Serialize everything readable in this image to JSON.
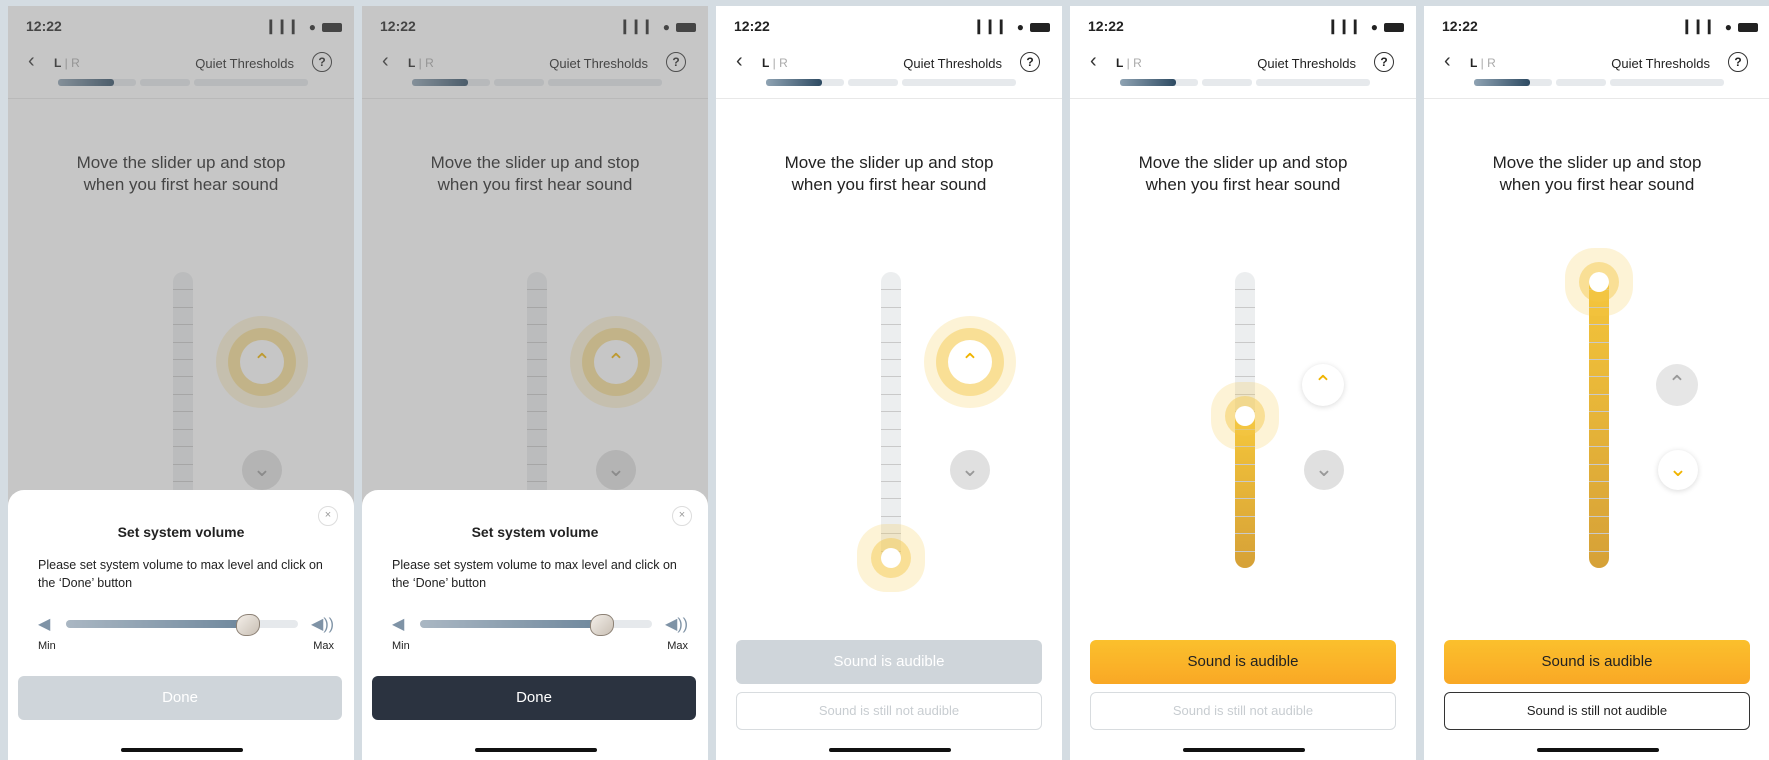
{
  "status": {
    "time": "12:22",
    "icons": "▎▎▎ ●"
  },
  "nav": {
    "back": "‹",
    "left_ear": "L",
    "right_ear": "R",
    "title": "Quiet Thresholds",
    "help": "?"
  },
  "progress": {
    "filled_fraction": 0.72
  },
  "instruction": {
    "line1": "Move the slider up and stop",
    "line2": "when you first hear sound"
  },
  "buttons": {
    "audible": "Sound is audible",
    "not_audible": "Sound is still not audible"
  },
  "sheet": {
    "title": "Set system volume",
    "description": "Please set system volume to max level and click on the ‘Done’ button",
    "min_label": "Min",
    "max_label": "Max",
    "volume_level": 0.78,
    "done_label": "Done",
    "close": "×"
  },
  "icons": {
    "up": "⌃",
    "down": "⌄",
    "speaker_min": "◀",
    "speaker_max": "◀))"
  },
  "accent_color": "#f9b825",
  "screens": [
    {
      "id": "s1",
      "slider_level": 0.0,
      "sheet_visible": true,
      "done_enabled": false
    },
    {
      "id": "s2",
      "slider_level": 0.0,
      "sheet_visible": true,
      "done_enabled": true
    },
    {
      "id": "s3",
      "slider_level": 0.0,
      "sheet_visible": false,
      "buttons_enabled": false
    },
    {
      "id": "s4",
      "slider_level": 0.52,
      "sheet_visible": false,
      "buttons_enabled": true
    },
    {
      "id": "s5",
      "slider_level": 1.0,
      "sheet_visible": false,
      "buttons_enabled": true,
      "not_audible_active": true
    }
  ]
}
